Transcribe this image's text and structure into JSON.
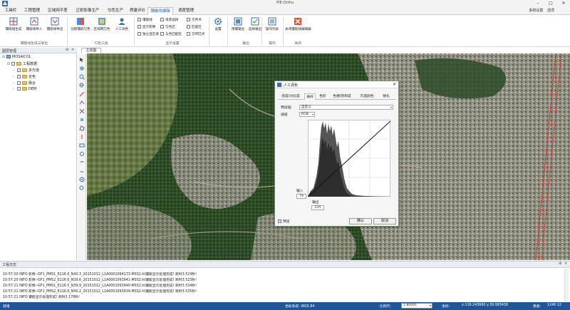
{
  "window": {
    "title": "PIE-Ortho",
    "system_settings": "系统设置",
    "system_menu": "选项"
  },
  "menu": {
    "tabs": [
      "工具栏",
      "工程管理",
      "区域网平差",
      "正射影像生产",
      "匀色生产",
      "质量评价",
      "镶嵌线编辑",
      "调度管理"
    ],
    "active_index": 6
  },
  "ribbon": {
    "group1": {
      "label": "镶嵌线生成与导出",
      "buttons": [
        "镶嵌线生成",
        "镶嵌线导入",
        "镶嵌线导出"
      ]
    },
    "group2": {
      "label": "匀色工具",
      "buttons": [
        "创建镶嵌匀色",
        "区域网匀色",
        "人工调色"
      ]
    },
    "group3": {
      "label": "显示设置",
      "checks": [
        "镶嵌线",
        "单景选择",
        "交所点",
        "显示影像",
        "匀色区",
        "匹配区",
        "独立显区域",
        "与色匹配区",
        "交所匹点"
      ]
    },
    "group4": {
      "buttons": [
        "设置"
      ]
    },
    "group5": {
      "label": "输出",
      "buttons": [
        "预镶输出",
        "选择输出"
      ]
    },
    "group6": {
      "label": "操作",
      "buttons": [
        "操作列表"
      ]
    },
    "group7": {
      "label": "关闭",
      "buttons": [
        "关闭镶嵌线编辑器"
      ]
    }
  },
  "left_panel": {
    "title": "图层管理",
    "tree": [
      {
        "label": "MOSAIC01",
        "level": 0,
        "kind": "root"
      },
      {
        "label": "工程数据",
        "level": 1,
        "kind": "folder"
      },
      {
        "label": "多光谱",
        "level": 2,
        "kind": "folder"
      },
      {
        "label": "全色",
        "level": 2,
        "kind": "folder"
      },
      {
        "label": "融合",
        "level": 2,
        "kind": "folder"
      },
      {
        "label": "DEM",
        "level": 2,
        "kind": "folder"
      }
    ]
  },
  "main": {
    "tab_label": "主视图"
  },
  "dialog": {
    "title": "人工调色",
    "tabs": [
      "亮度/对比度",
      "曲线",
      "色阶",
      "色相/饱和度",
      "可选颜色",
      "锐化"
    ],
    "active_tab": 1,
    "preset_label": "预设值:",
    "preset_value": "自定义",
    "channel_label": "通道",
    "channel_value": "RGB",
    "input_label": "输入",
    "input_value": "74",
    "output_label": "输出",
    "output_value": "235",
    "preview_label": "预览",
    "ok": "确认",
    "cancel": "取消"
  },
  "log": {
    "title": "工程日志",
    "lines": [
      "10:57:20 INFO 影像--GF1_PMS1_E116.6_N40.3_20151012_L1A0001094173-MSS1:纠镶嵌显示处理完成! 耗时3.524秒!",
      "10:57:20 INFO 影像--GF1_PMS2_E116.6_N39.6_20151012_L1A0001093941-MSS2:纠镶嵌显示处理完成! 耗时3.523秒!",
      "10:57:21 INFO 影像--GF1_PMS1_E116.5_N39.9_20151012_L1A0001093940-MSS1:纠镶嵌显示处理完成! 耗时3.534秒!",
      "10:57:21 INFO 影像--GF1_PMS2_E116.6_N40.2_20151012_L1A0001093939-MSS2:纠镶嵌显示处理完成! 耗时3.535秒!",
      "10:57:21 INFO 镶嵌显示处理完成! 耗时3.178秒!"
    ]
  },
  "statusbar": {
    "ready": "就绪",
    "coord_system": "坐标系统: WGS 84",
    "scale_label": "比例尺:",
    "scale_value": "1:80001",
    "coords_label": "坐标:",
    "coords_value": "x:116.243660 y:39.993436",
    "unit_label": "像素:",
    "unit_value": "1240 12"
  },
  "colors": {
    "accent": "#1f5fae",
    "status_bg": "#1e5799",
    "mosaic_line": "#e0312a"
  }
}
